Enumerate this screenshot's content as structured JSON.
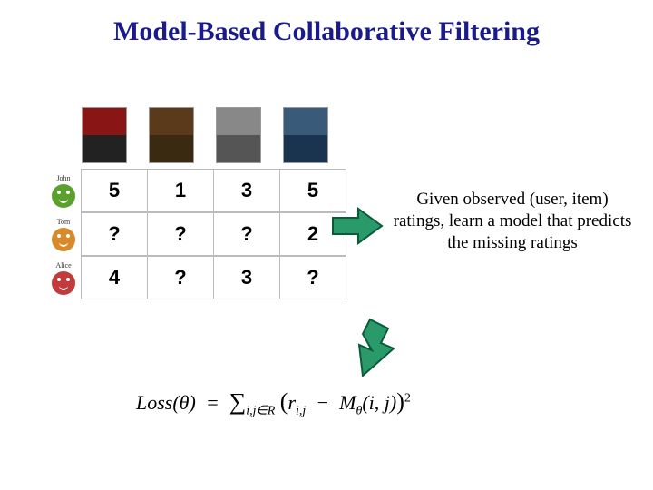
{
  "title": "Model-Based Collaborative Filtering",
  "users": [
    {
      "name": "John",
      "avatar_color": "green"
    },
    {
      "name": "Tom",
      "avatar_color": "orange"
    },
    {
      "name": "Alice",
      "avatar_color": "red"
    }
  ],
  "ratings": [
    [
      "5",
      "1",
      "3",
      "5"
    ],
    [
      "?",
      "?",
      "?",
      "2"
    ],
    [
      "4",
      "?",
      "3",
      "?"
    ]
  ],
  "description": "Given observed (user, item) ratings, learn a model that predicts the missing ratings",
  "formula": {
    "lhs": "Loss(θ)",
    "sum_sub": "i,j∈R",
    "r_sub": "i,j",
    "m_sub": "θ",
    "m_args": "(i, j)",
    "exponent": "2"
  }
}
